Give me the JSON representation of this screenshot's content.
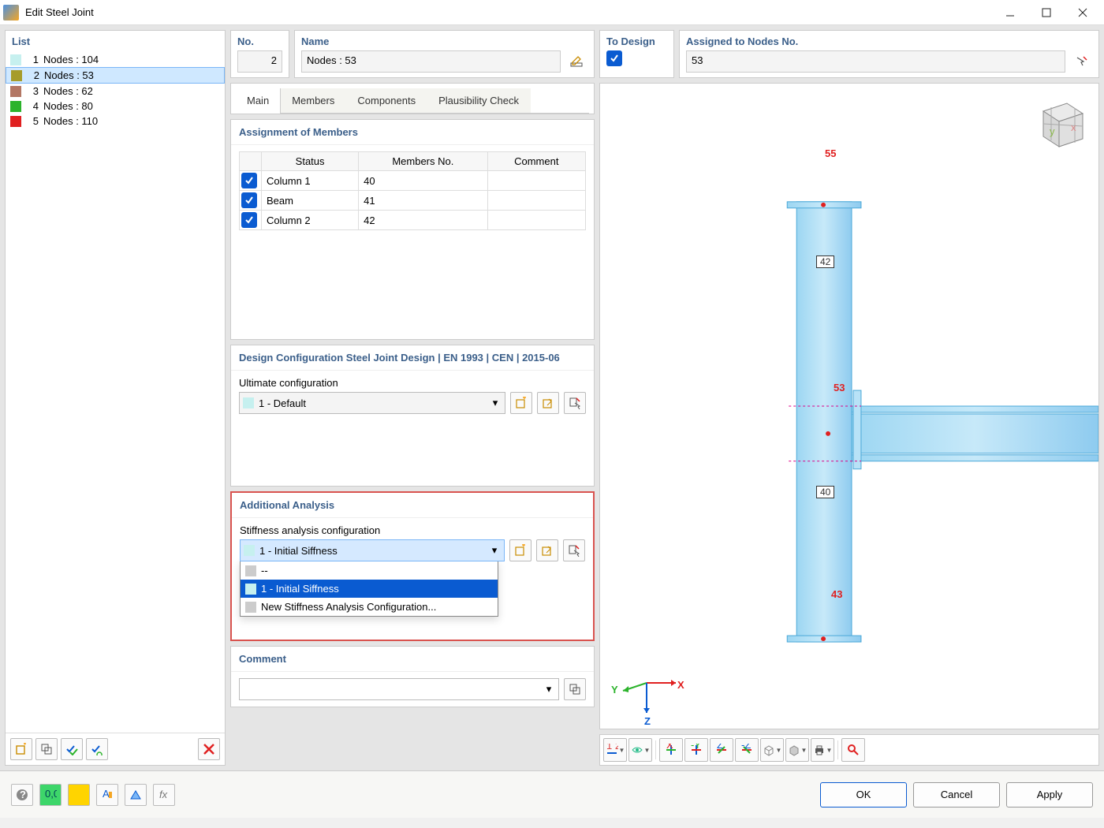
{
  "window": {
    "title": "Edit Steel Joint"
  },
  "list": {
    "header": "List",
    "items": [
      {
        "idx": "1",
        "label": "Nodes : 104",
        "color": "#c6f0ef"
      },
      {
        "idx": "2",
        "label": "Nodes : 53",
        "color": "#a69c2b",
        "selected": true
      },
      {
        "idx": "3",
        "label": "Nodes : 62",
        "color": "#b37764"
      },
      {
        "idx": "4",
        "label": "Nodes : 80",
        "color": "#2bb32b"
      },
      {
        "idx": "5",
        "label": "Nodes : 110",
        "color": "#e02020"
      }
    ]
  },
  "top": {
    "no_label": "No.",
    "no_value": "2",
    "name_label": "Name",
    "name_value": "Nodes : 53",
    "todesign_label": "To Design",
    "assigned_label": "Assigned to Nodes No.",
    "assigned_value": "53"
  },
  "tabs": {
    "items": [
      "Main",
      "Members",
      "Components",
      "Plausibility Check"
    ],
    "active": 0
  },
  "members_section": {
    "header": "Assignment of Members",
    "columns": [
      "Status",
      "Members No.",
      "Comment"
    ],
    "rows": [
      {
        "status": "Column 1",
        "no": "40",
        "comment": ""
      },
      {
        "status": "Beam",
        "no": "41",
        "comment": ""
      },
      {
        "status": "Column 2",
        "no": "42",
        "comment": ""
      }
    ]
  },
  "design_cfg": {
    "header": "Design Configuration Steel Joint Design | EN 1993 | CEN | 2015-06",
    "sub": "Ultimate configuration",
    "value": "1 - Default",
    "swatch": "#c6f0ef"
  },
  "additional": {
    "header": "Additional Analysis",
    "sub": "Stiffness analysis configuration",
    "value": "1 - Initial Siffness",
    "swatch": "#c6f0ef",
    "options": [
      {
        "label": "--"
      },
      {
        "label": "1 - Initial Siffness",
        "selected": true
      },
      {
        "label": "New Stiffness Analysis Configuration..."
      }
    ]
  },
  "comment": {
    "header": "Comment",
    "value": ""
  },
  "viewport": {
    "members": {
      "m40": "40",
      "m42": "42"
    },
    "nodes": {
      "n55": "55",
      "n53": "53",
      "n43": "43"
    },
    "axes": {
      "x": "X",
      "y": "Y",
      "z": "Z"
    }
  },
  "footer": {
    "ok": "OK",
    "cancel": "Cancel",
    "apply": "Apply"
  }
}
